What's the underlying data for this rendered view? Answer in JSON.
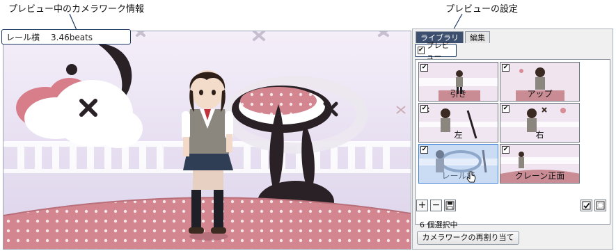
{
  "callouts": {
    "camera_info": "プレビュー中のカメラワーク情報",
    "preview_settings": "プレビューの設定"
  },
  "info": {
    "camera_name": "レール横",
    "beats": "3.46beats"
  },
  "panel": {
    "tabs": [
      {
        "label": "ライブラリ",
        "active": true
      },
      {
        "label": "編集",
        "active": false
      }
    ],
    "preview_checkbox": {
      "label": "プレビュー",
      "checked": true
    },
    "thumbnails": [
      {
        "label": "引き",
        "checked": true,
        "selected": false
      },
      {
        "label": "アップ",
        "checked": true,
        "selected": false
      },
      {
        "label": "左",
        "checked": true,
        "selected": false
      },
      {
        "label": "右",
        "checked": true,
        "selected": false
      },
      {
        "label": "レール横",
        "checked": true,
        "selected": true
      },
      {
        "label": "クレーン正面",
        "checked": true,
        "selected": false
      }
    ],
    "toolbar": {
      "add_symbol": "+",
      "remove_symbol": "−",
      "save_icon": "save-icon",
      "check_all_icon": "check-all-icon",
      "uncheck_all_icon": "uncheck-all-icon"
    },
    "status": "6 個選択中",
    "reassign_button": "カメラワークの再割り当て"
  },
  "colors": {
    "accent_box": "#1e3a64",
    "selection": "#3d7fd6",
    "tab_active": "#3c4f6e",
    "stage_floor": "#c98c95"
  }
}
